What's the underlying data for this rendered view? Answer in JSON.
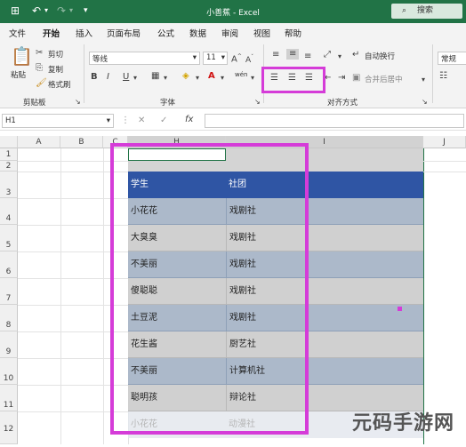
{
  "titlebar": {
    "title": "小善蕉 - Excel",
    "search_placeholder": "搜索",
    "bg_color": "#217346"
  },
  "tabs": [
    "文件",
    "开始",
    "插入",
    "页面布局",
    "公式",
    "数据",
    "审阅",
    "视图",
    "帮助"
  ],
  "active_tab": "开始",
  "ribbon": {
    "paste": "粘贴",
    "cut": "剪切",
    "copy": "复制",
    "format_painter": "格式刷",
    "clipboard_group": "剪贴板",
    "font_name": "等线",
    "font_size": "11",
    "font_group": "字体",
    "wrap_text": "自动换行",
    "merge_center": "合并后居中",
    "alignment_group": "对齐方式",
    "number_format": "常规",
    "wen": "wén"
  },
  "formula_bar": {
    "name_box": "H1",
    "fx": "fx",
    "value": ""
  },
  "columns": [
    "A",
    "B",
    "C",
    "H",
    "I",
    "J"
  ],
  "rows": [
    "1",
    "2",
    "3",
    "4",
    "5",
    "6",
    "7",
    "8",
    "9",
    "10",
    "11",
    "12"
  ],
  "table": {
    "header": [
      "学生",
      "社团"
    ],
    "header_bg": "#2f55a4",
    "row_blue": "#acb9ca",
    "row_gray": "#d0d0d0",
    "rows": [
      [
        "小花花",
        "戏剧社"
      ],
      [
        "大臭臭",
        "戏剧社"
      ],
      [
        "不美丽",
        "戏剧社"
      ],
      [
        "傻聪聪",
        "戏剧社"
      ],
      [
        "土豆泥",
        "戏剧社"
      ],
      [
        "花生酱",
        "厨艺社"
      ],
      [
        "不美丽",
        "计算机社"
      ],
      [
        "聪明孩",
        "辩论社"
      ],
      [
        "小花花",
        "动漫社"
      ]
    ]
  },
  "highlight_color": "#d53cd8",
  "watermark": "元码手游网"
}
